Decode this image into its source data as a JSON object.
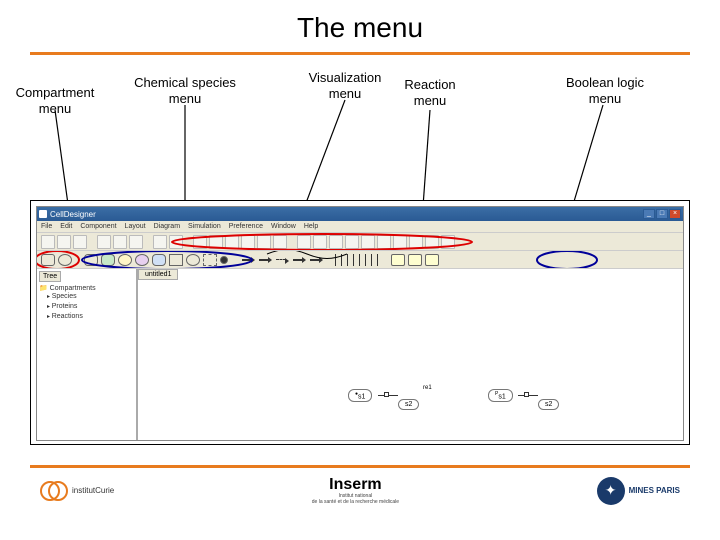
{
  "title": "The menu",
  "labels": {
    "compartment": "Compartment\nmenu",
    "chemical": "Chemical species\nmenu",
    "visualization": "Visualization\nmenu",
    "reaction": "Reaction\nmenu",
    "boolean": "Boolean logic\nmenu"
  },
  "app": {
    "title": "CellDesigner",
    "menubar": [
      "File",
      "Edit",
      "Component",
      "Layout",
      "Diagram",
      "Simulation",
      "Preference",
      "Window",
      "Help"
    ],
    "tree": {
      "tab": "Tree",
      "root": "Compartments",
      "items": [
        "Species",
        "Proteins",
        "Reactions"
      ]
    },
    "canvas": {
      "tab": "untitled1",
      "nodes": {
        "s1": "s1",
        "s2a": "s2",
        "s2b": "s2",
        "s1b": "s1"
      },
      "reaction_label": "re1"
    }
  },
  "logos": {
    "curie": "institutCurie",
    "inserm": "Inserm",
    "inserm_sub": "Institut national\nde la santé et de la recherche médicale",
    "mines": "MINES PARIS"
  }
}
